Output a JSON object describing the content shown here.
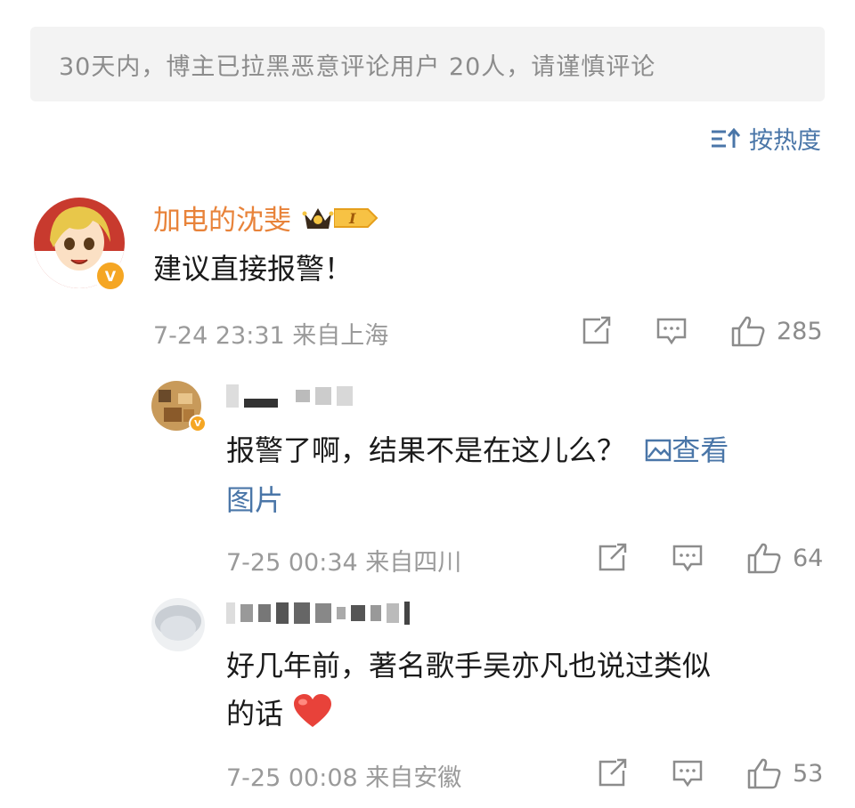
{
  "notice": {
    "text": "30天内，博主已拉黑恶意评论用户 20人，请谨慎评论"
  },
  "sort": {
    "label": "按热度",
    "icon": "sort-icon"
  },
  "colors": {
    "accent_link": "#4a76a8",
    "username_orange": "#e8833a",
    "meta_gray": "#9a9a9a"
  },
  "comments": [
    {
      "username": "加电的沈斐",
      "badge_text": "I",
      "text": "建议直接报警！",
      "time": "7-24 23:31",
      "location": "来自上海",
      "likes": "285"
    }
  ],
  "replies": [
    {
      "text": "报警了啊，结果不是在这儿么？",
      "view_image_label": "查看",
      "view_image_label2": "图片",
      "time": "7-25 00:34",
      "location": "来自四川",
      "likes": "64"
    },
    {
      "text_line1": "好几年前，著名歌手吴亦凡也说过类似",
      "text_line2": "的话",
      "time": "7-25 00:08",
      "location": "来自安徽",
      "likes": "53"
    }
  ]
}
